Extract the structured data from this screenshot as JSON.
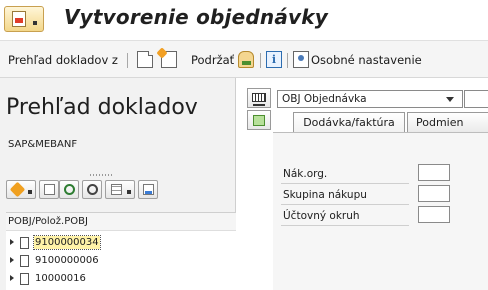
{
  "window": {
    "title": "Vytvorenie objednávky"
  },
  "toolbar": {
    "overview_label": "Prehľad dokladov z",
    "hold_label": "Podržať",
    "personal_settings_label": "Osobné nastavenie"
  },
  "left_panel": {
    "title": "Prehľad dokladov",
    "subtitle": "SAP&MEBANF",
    "tree_header": "POBJ/Polož.POBJ",
    "tree_items": [
      {
        "label": "9100000034",
        "selected": true
      },
      {
        "label": "9100000006",
        "selected": false
      },
      {
        "label": "10000016",
        "selected": false
      }
    ]
  },
  "document": {
    "doc_type_value": "OBJ Objednávka",
    "tabs": [
      {
        "label": "Dodávka/faktúra"
      },
      {
        "label": "Podmien"
      }
    ],
    "fields": [
      {
        "label": "Nák.org.",
        "value": ""
      },
      {
        "label": "Skupina nákupu",
        "value": ""
      },
      {
        "label": "Účtovný okruh",
        "value": ""
      }
    ]
  },
  "colors": {
    "toolbar_bg": "#f5f5f5",
    "panel_bg": "#f2f2f2",
    "selection_highlight": "#fff3a8"
  },
  "icons": [
    "document-menu-icon",
    "new-document-icon",
    "other-document-icon",
    "hold-icon",
    "info-icon",
    "personal-settings-icon",
    "cart-icon",
    "header-toggle-icon"
  ]
}
